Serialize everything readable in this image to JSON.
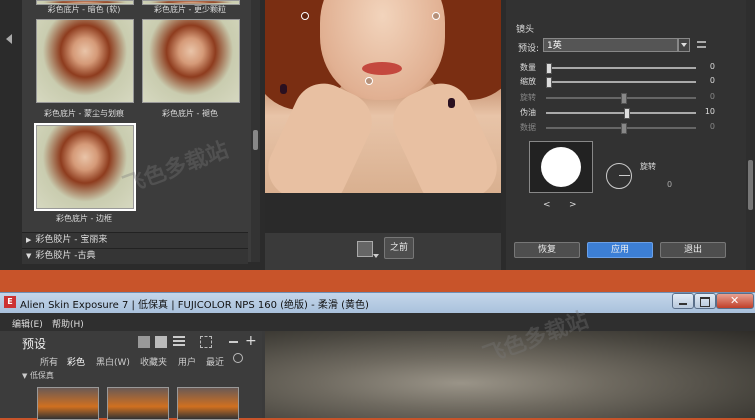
{
  "top": {
    "thumbs": [
      {
        "caption": "彩色底片 - 暗色 (软)"
      },
      {
        "caption": "彩色底片 - 更少颗粒"
      },
      {
        "caption": "彩色底片 - 蒙尘与划痕"
      },
      {
        "caption": "彩色底片 - 褪色"
      },
      {
        "caption": "彩色底片 - 边框"
      }
    ],
    "categories": [
      {
        "label": "彩色胶片 - 宝丽来",
        "expanded": false
      },
      {
        "label": "彩色胶片 -古典",
        "expanded": true
      }
    ],
    "compare_label": "之前",
    "lens": {
      "section_title": "镜头",
      "preset_label": "预设:",
      "preset_value": "1英",
      "sliders": [
        {
          "label": "数量",
          "value": "0",
          "fraction": 0.0,
          "enabled": true
        },
        {
          "label": "缩放",
          "value": "0",
          "fraction": 0.0,
          "enabled": true
        },
        {
          "label": "旋转",
          "value": "0",
          "fraction": 0.5,
          "enabled": false
        },
        {
          "label": "伪油",
          "value": "10",
          "fraction": 0.52,
          "enabled": true
        },
        {
          "label": "数据",
          "value": "0",
          "fraction": 0.5,
          "enabled": false
        }
      ],
      "rotate_label": "旋转",
      "rotate_value": "0",
      "prev_arrow": "<",
      "next_arrow": ">"
    },
    "buttons": {
      "reset": "恢复",
      "apply": "应用",
      "exit": "退出"
    },
    "colors": {
      "apply_accent": "#3c7fd6"
    }
  },
  "bottom": {
    "window_title": "Alien Skin Exposure 7 | 低保真 | FUJICOLOR NPS 160 (绝版) - 柔滑 (黄色)",
    "app_icon_letter": "E",
    "menu": [
      "编辑(E)",
      "帮助(H)"
    ],
    "panel_title": "预设",
    "tabs": [
      "所有",
      "彩色",
      "黑白(W)",
      "收藏夹",
      "用户",
      "最近"
    ],
    "group_label": "低保真"
  },
  "watermark": "飞色多载站"
}
